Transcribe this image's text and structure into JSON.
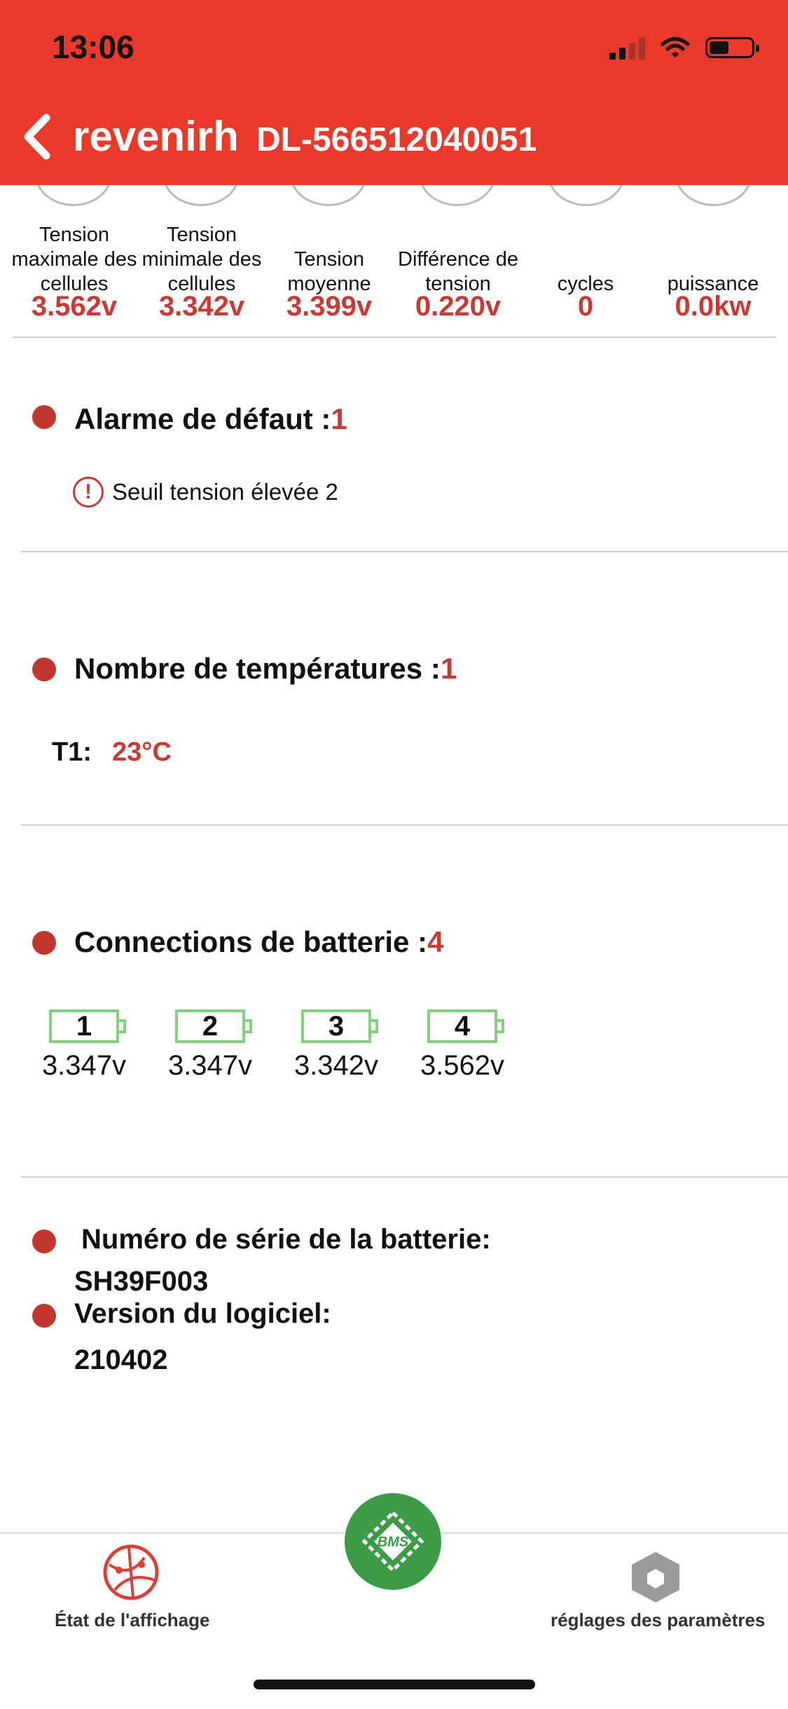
{
  "status_bar": {
    "time": "13:06"
  },
  "header": {
    "title": "revenirh",
    "device_id": "DL-566512040051"
  },
  "stats": [
    {
      "label": "Tension maximale des cellules",
      "value": "3.562v"
    },
    {
      "label": "Tension minimale des cellules",
      "value": "3.342v"
    },
    {
      "label": "Tension moyenne",
      "value": "3.399v"
    },
    {
      "label": "Différence de tension",
      "value": "0.220v"
    },
    {
      "label": "cycles",
      "value": "0"
    },
    {
      "label": "puissance",
      "value": "0.0kw"
    }
  ],
  "alarm": {
    "title": "Alarme de défaut :",
    "count": "1",
    "items": [
      "Seuil tension élevée 2"
    ]
  },
  "temperatures": {
    "title": "Nombre de températures :",
    "count": "1",
    "items": [
      {
        "name": "T1:",
        "value": "23°C"
      }
    ]
  },
  "connections": {
    "title": "Connections de batterie :",
    "count": "4",
    "cells": [
      {
        "index": "1",
        "voltage": "3.347v"
      },
      {
        "index": "2",
        "voltage": "3.347v"
      },
      {
        "index": "3",
        "voltage": "3.342v"
      },
      {
        "index": "4",
        "voltage": "3.562v"
      }
    ]
  },
  "info": {
    "serial_label": "Numéro de série de la batterie:",
    "serial_value": "SH39F003",
    "version_label": "Version du logiciel:",
    "version_value": "210402"
  },
  "tabbar": {
    "left_label": "État de l'affichage",
    "center_badge": "BMS",
    "right_label": "réglages des paramètres"
  },
  "colors": {
    "header_bg": "#e8392a",
    "accent_red": "#c93a35",
    "battery_green": "#86cf7e",
    "bms_green": "#3b9b46"
  }
}
